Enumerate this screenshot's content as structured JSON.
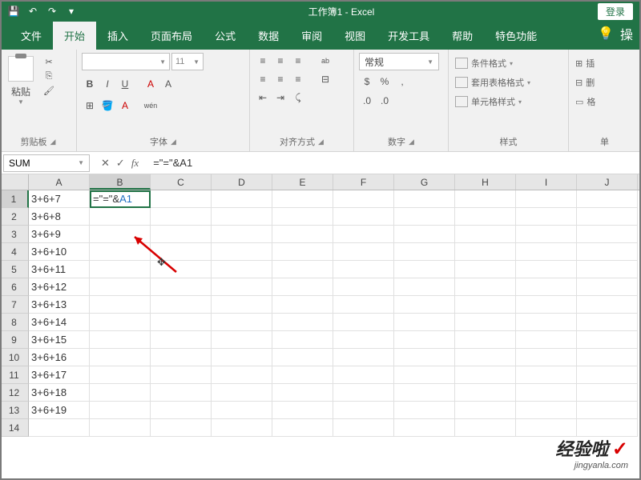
{
  "title": "工作簿1 - Excel",
  "login": "登录",
  "tabs": {
    "file": "文件",
    "home": "开始",
    "insert": "插入",
    "layout": "页面布局",
    "formulas": "公式",
    "data": "数据",
    "review": "审阅",
    "view": "视图",
    "dev": "开发工具",
    "help": "帮助",
    "special": "特色功能",
    "tell": "操"
  },
  "ribbon": {
    "clipboard": {
      "label": "剪贴板",
      "paste": "粘贴"
    },
    "font": {
      "label": "字体",
      "placeholder": "",
      "size": "11",
      "bold": "B",
      "italic": "I",
      "underline": "U",
      "fontA": "A",
      "aa": "A",
      "wen": "wén"
    },
    "alignment": {
      "label": "对齐方式",
      "wrap": "ab"
    },
    "number": {
      "label": "数字",
      "general": "常规",
      "percent": "%"
    },
    "styles": {
      "label": "样式",
      "cond": "条件格式",
      "table": "套用表格格式",
      "cell": "单元格样式"
    },
    "cells": {
      "label": "单",
      "insert": "插",
      "delete": "删",
      "format": "格"
    }
  },
  "namebox": "SUM",
  "fx_cancel": "✕",
  "fx_enter": "✓",
  "fx_label": "fx",
  "formula": "=\"=\"&A1",
  "formula_display_prefix": "=\"=\"&",
  "formula_display_ref": "A1",
  "columns": [
    "A",
    "B",
    "C",
    "D",
    "E",
    "F",
    "G",
    "H",
    "I",
    "J"
  ],
  "rows": [
    {
      "n": "1",
      "a": "3+6+7"
    },
    {
      "n": "2",
      "a": "3+6+8"
    },
    {
      "n": "3",
      "a": "3+6+9"
    },
    {
      "n": "4",
      "a": "3+6+10"
    },
    {
      "n": "5",
      "a": "3+6+11"
    },
    {
      "n": "6",
      "a": "3+6+12"
    },
    {
      "n": "7",
      "a": "3+6+13"
    },
    {
      "n": "8",
      "a": "3+6+14"
    },
    {
      "n": "9",
      "a": "3+6+15"
    },
    {
      "n": "10",
      "a": "3+6+16"
    },
    {
      "n": "11",
      "a": "3+6+17"
    },
    {
      "n": "12",
      "a": "3+6+18"
    },
    {
      "n": "13",
      "a": "3+6+19"
    },
    {
      "n": "14",
      "a": ""
    }
  ],
  "watermark": {
    "main": "经验啦",
    "check": "✓",
    "sub": "jingyanla.com"
  }
}
